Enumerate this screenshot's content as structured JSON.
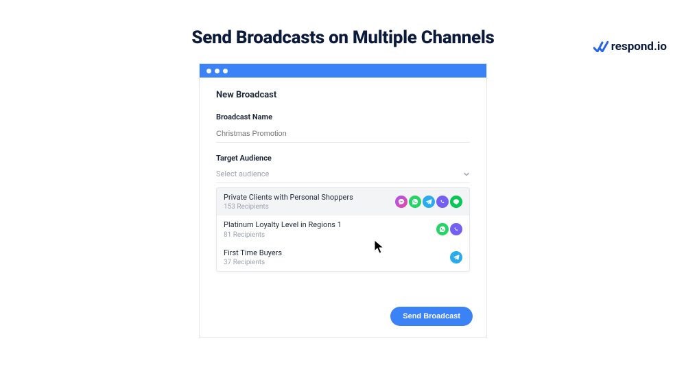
{
  "brand": {
    "name": "respond.io",
    "accent": "#3b82f6"
  },
  "page_title": "Send Broadcasts on Multiple Channels",
  "modal": {
    "title": "New Broadcast",
    "name_field": {
      "label": "Broadcast Name",
      "placeholder": "Christmas Promotion"
    },
    "audience_field": {
      "label": "Target Audience",
      "placeholder": "Select audience"
    },
    "send_button": "Send Broadcast"
  },
  "audiences": [
    {
      "label": "Private Clients with Personal Shoppers",
      "sub": "153 Recipients",
      "channels": [
        "messenger",
        "whatsapp",
        "telegram",
        "viber",
        "line"
      ],
      "hovered": true
    },
    {
      "label": "Platinum Loyalty Level in Regions 1",
      "sub": "81 Recipients",
      "channels": [
        "whatsapp",
        "viber"
      ],
      "hovered": false
    },
    {
      "label": "First Time Buyers",
      "sub": "37 Recipients",
      "channels": [
        "telegram"
      ],
      "hovered": false
    }
  ]
}
